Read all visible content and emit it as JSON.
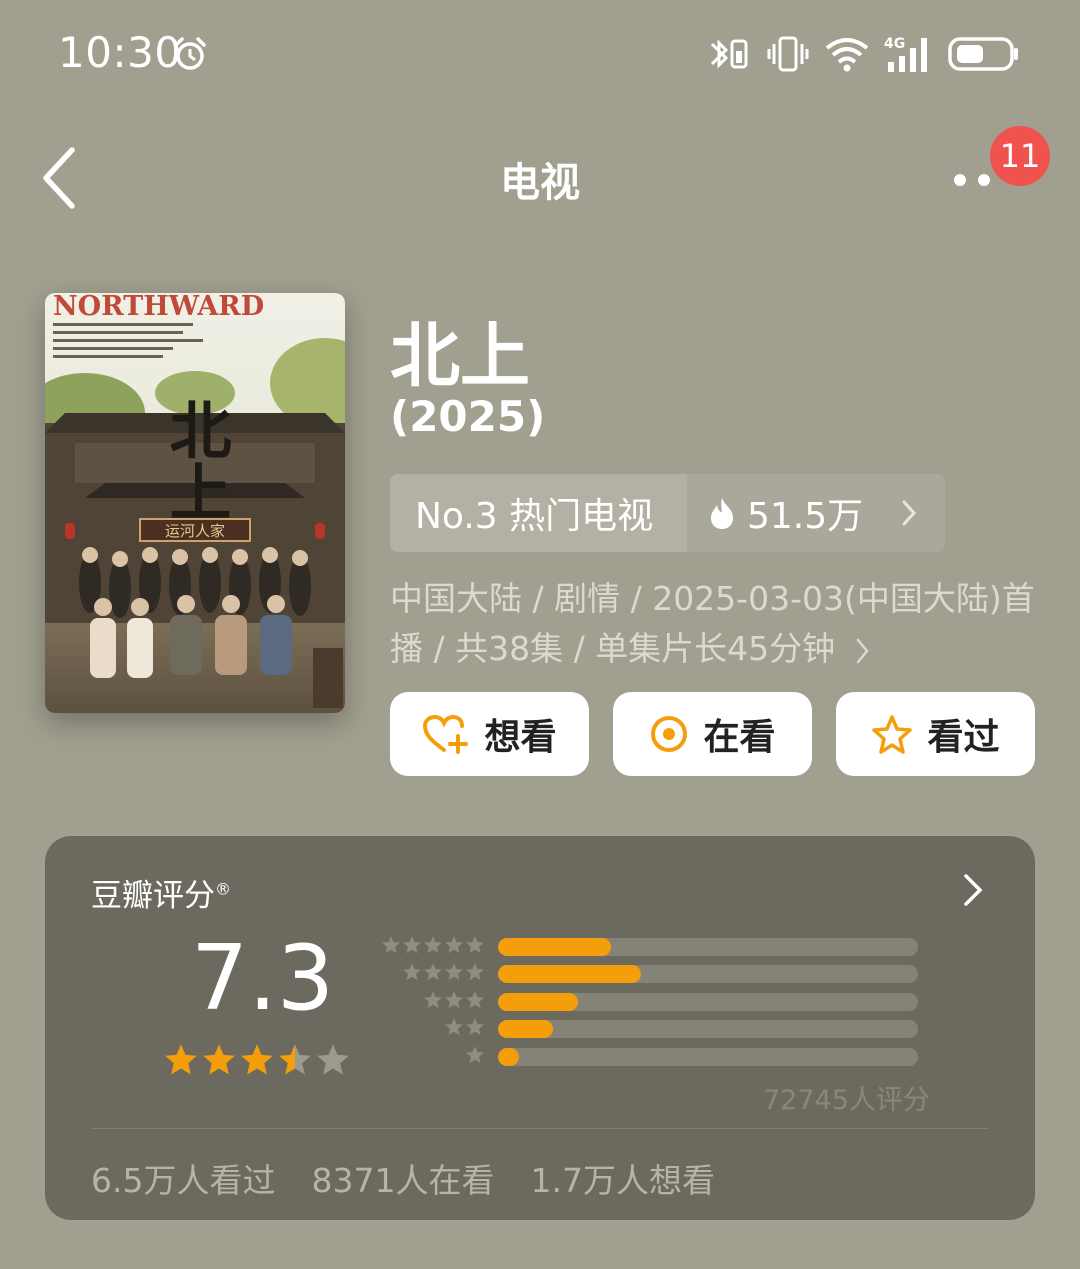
{
  "status_bar": {
    "time": "10:30",
    "icons": [
      "alarm-icon",
      "bluetooth-icon",
      "vibrate-icon",
      "wifi-icon",
      "signal-4g-icon",
      "battery-icon"
    ]
  },
  "nav": {
    "title": "电视",
    "back_icon": "chevron-left-icon",
    "more_icon": "more-dots-icon",
    "badge_count": "11"
  },
  "poster": {
    "header_text": "NORTHWARD",
    "calligraphy": "北上",
    "sign_text": "运河人家"
  },
  "movie": {
    "title": "北上",
    "year": "(2025)"
  },
  "rank": {
    "label": "No.3 热门电视",
    "hot_value": "51.5万",
    "hot_icon": "fire-icon"
  },
  "meta": {
    "text": "中国大陆 / 剧情 / 2025-03-03(中国大陆)首播 / 共38集 / 单集片长45分钟"
  },
  "actions": [
    {
      "label": "想看",
      "icon": "heart-plus-icon"
    },
    {
      "label": "在看",
      "icon": "target-circle-icon"
    },
    {
      "label": "看过",
      "icon": "star-outline-icon"
    }
  ],
  "rating": {
    "title": "豆瓣评分",
    "registered_mark": "®",
    "score": "7.3",
    "stars_filled": 3.5,
    "stars_total": 5,
    "distribution": [
      {
        "stars": 5,
        "fraction": 0.27
      },
      {
        "stars": 4,
        "fraction": 0.34
      },
      {
        "stars": 3,
        "fraction": 0.19
      },
      {
        "stars": 2,
        "fraction": 0.13
      },
      {
        "stars": 1,
        "fraction": 0.05
      }
    ],
    "count_text": "72745人评分",
    "stats": [
      "6.5万人看过",
      "8371人在看",
      "1.7万人想看"
    ]
  },
  "colors": {
    "background": "#a19f8f",
    "card": "#6c6a5f",
    "accent_orange": "#f59e0b",
    "badge_red": "#f0524e"
  }
}
